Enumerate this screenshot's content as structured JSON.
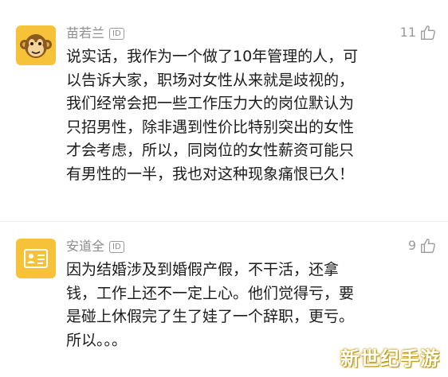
{
  "comments": [
    {
      "name": "苗若兰",
      "badge": "ID",
      "likes": "11",
      "avatar_icon": "monkey-avatar-icon",
      "lines": [
        "说实话，我作为一个做了10年管理的人，可",
        "以告诉大家，职场对女性从来就是歧视的，",
        "我们经常会把一些工作压力大的岗位默认为",
        "只招男性，除非遇到性价比特别突出的女性",
        "才会考虑，所以，同岗位的女性薪资可能只",
        "有男性的一半，我也对这种现象痛恨已久！"
      ]
    },
    {
      "name": "安道全",
      "badge": "ID",
      "likes": "9",
      "avatar_icon": "id-card-avatar-icon",
      "lines": [
        "因为结婚涉及到婚假产假，不干活，还拿",
        "钱，工作上还不一定上心。他们觉得亏，要",
        "是碰上休假完了生了娃了一个辞职，更亏。",
        "所以。。。"
      ]
    }
  ],
  "watermark": "新世纪手游",
  "colors": {
    "avatar_bg": "#f6c23a",
    "name": "#8c8c8c",
    "text": "#1c1c1c",
    "like": "#9a9a9a"
  }
}
